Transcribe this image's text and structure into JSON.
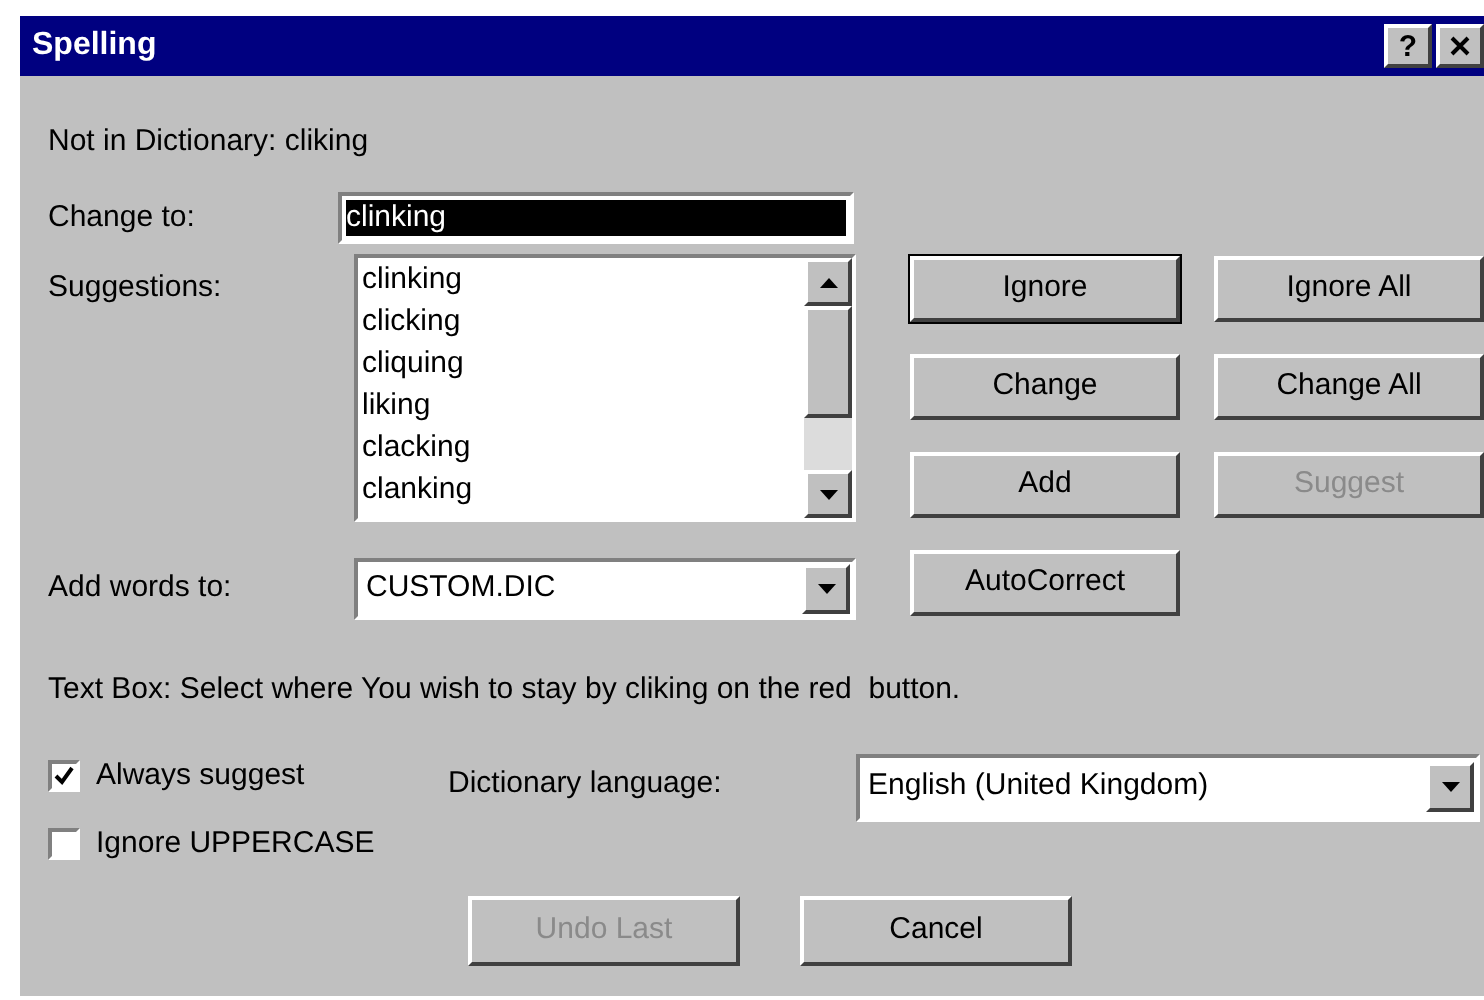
{
  "window": {
    "title": "Spelling",
    "help_button": "?"
  },
  "not_in_dictionary": "Not in Dictionary: cliking",
  "change_to": {
    "label": "Change to:",
    "value": "clinking",
    "text_selected": true
  },
  "suggestions": {
    "label": "Suggestions:",
    "items": [
      {
        "text": "clinking",
        "selected": false
      },
      {
        "text": "clicking",
        "selected": false
      },
      {
        "text": "cliquing",
        "selected": false
      },
      {
        "text": "liking",
        "selected": false
      },
      {
        "text": "clacking",
        "selected": false
      },
      {
        "text": "clanking",
        "selected": false
      }
    ]
  },
  "add_words_to": {
    "label": "Add words to:",
    "value": "CUSTOM.DIC"
  },
  "buttons": [
    {
      "label": "Ignore",
      "disabled": false,
      "default": true
    },
    {
      "label": "Ignore All",
      "disabled": false,
      "default": false
    },
    {
      "label": "Change",
      "disabled": false,
      "default": false
    },
    {
      "label": "Change All",
      "disabled": false,
      "default": false
    },
    {
      "label": "Add",
      "disabled": false,
      "default": false
    },
    {
      "label": "Suggest",
      "disabled": true,
      "default": false
    },
    {
      "label": "AutoCorrect",
      "disabled": false,
      "default": false
    }
  ],
  "message": "Text Box: Select where You wish to stay by cliking on the red  button.",
  "checkboxes": [
    {
      "label": "Always suggest",
      "checked": true
    },
    {
      "label": "Ignore UPPERCASE",
      "checked": false
    }
  ],
  "dictionary_language": {
    "label": "Dictionary language:",
    "value": "English (United Kingdom)"
  },
  "bottom_buttons": [
    {
      "label": "Undo Last",
      "disabled": true
    },
    {
      "label": "Cancel",
      "disabled": false
    }
  ]
}
